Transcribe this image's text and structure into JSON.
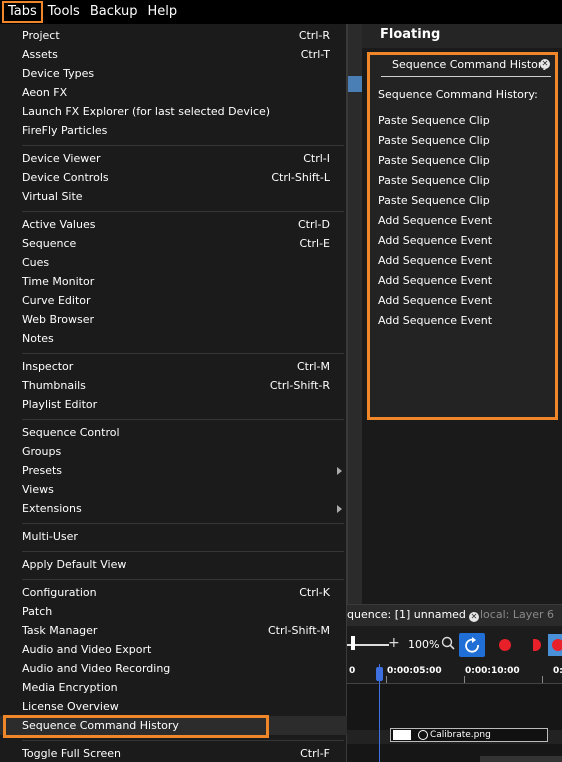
{
  "menubar": {
    "items": [
      "Tabs",
      "Tools",
      "Backup",
      "Help"
    ]
  },
  "colors": {
    "highlight": "#f0862a",
    "accent_blue": "#1f6fd6",
    "record_red": "#e8202a"
  },
  "floating": {
    "title": "Floating",
    "panel": {
      "tab_label": "Sequence Command History",
      "heading": "Sequence Command History:",
      "entries": [
        "Paste Sequence Clip",
        "Paste Sequence Clip",
        "Paste Sequence Clip",
        "Paste Sequence Clip",
        "Paste Sequence Clip",
        "Add Sequence Event",
        "Add Sequence Event",
        "Add Sequence Event",
        "Add Sequence Event",
        "Add Sequence Event",
        "Add Sequence Event"
      ]
    }
  },
  "sequence": {
    "tab_active": "quence: [1] unnamed",
    "tab_inactive": "local: Layer 6",
    "zoom": "100%",
    "ruler": [
      "0",
      "0:00:05:00",
      "0:00:10:00",
      "0:"
    ],
    "clip_name": "Calibrate.png"
  },
  "tabs_menu": {
    "items": [
      {
        "label": "Project",
        "shortcut": "Ctrl-R"
      },
      {
        "label": "Assets",
        "shortcut": "Ctrl-T"
      },
      {
        "label": "Device Types",
        "shortcut": ""
      },
      {
        "label": "Aeon FX",
        "shortcut": ""
      },
      {
        "label": "Launch FX Explorer (for last selected Device)",
        "shortcut": ""
      },
      {
        "label": "FireFly Particles",
        "shortcut": ""
      },
      {
        "label": "Device Viewer",
        "shortcut": "Ctrl-I"
      },
      {
        "label": "Device Controls",
        "shortcut": "Ctrl-Shift-L"
      },
      {
        "label": "Virtual Site",
        "shortcut": ""
      },
      {
        "label": "Active Values",
        "shortcut": "Ctrl-D"
      },
      {
        "label": "Sequence",
        "shortcut": "Ctrl-E"
      },
      {
        "label": "Cues",
        "shortcut": ""
      },
      {
        "label": "Time Monitor",
        "shortcut": ""
      },
      {
        "label": "Curve Editor",
        "shortcut": ""
      },
      {
        "label": "Web Browser",
        "shortcut": ""
      },
      {
        "label": "Notes",
        "shortcut": ""
      },
      {
        "label": "Inspector",
        "shortcut": "Ctrl-M"
      },
      {
        "label": "Thumbnails",
        "shortcut": "Ctrl-Shift-R"
      },
      {
        "label": "Playlist Editor",
        "shortcut": ""
      },
      {
        "label": "Sequence Control",
        "shortcut": ""
      },
      {
        "label": "Groups",
        "shortcut": ""
      },
      {
        "label": "Presets",
        "shortcut": ""
      },
      {
        "label": "Views",
        "shortcut": ""
      },
      {
        "label": "Extensions",
        "shortcut": ""
      },
      {
        "label": "Multi-User",
        "shortcut": ""
      },
      {
        "label": "Apply Default View",
        "shortcut": ""
      },
      {
        "label": "Configuration",
        "shortcut": "Ctrl-K"
      },
      {
        "label": "Patch",
        "shortcut": ""
      },
      {
        "label": "Task Manager",
        "shortcut": "Ctrl-Shift-M"
      },
      {
        "label": "Audio and Video Export",
        "shortcut": ""
      },
      {
        "label": "Audio and Video Recording",
        "shortcut": ""
      },
      {
        "label": "Media Encryption",
        "shortcut": ""
      },
      {
        "label": "License Overview",
        "shortcut": ""
      },
      {
        "label": "Sequence Command History",
        "shortcut": ""
      },
      {
        "label": "Toggle Full Screen",
        "shortcut": "Ctrl-F"
      }
    ]
  }
}
